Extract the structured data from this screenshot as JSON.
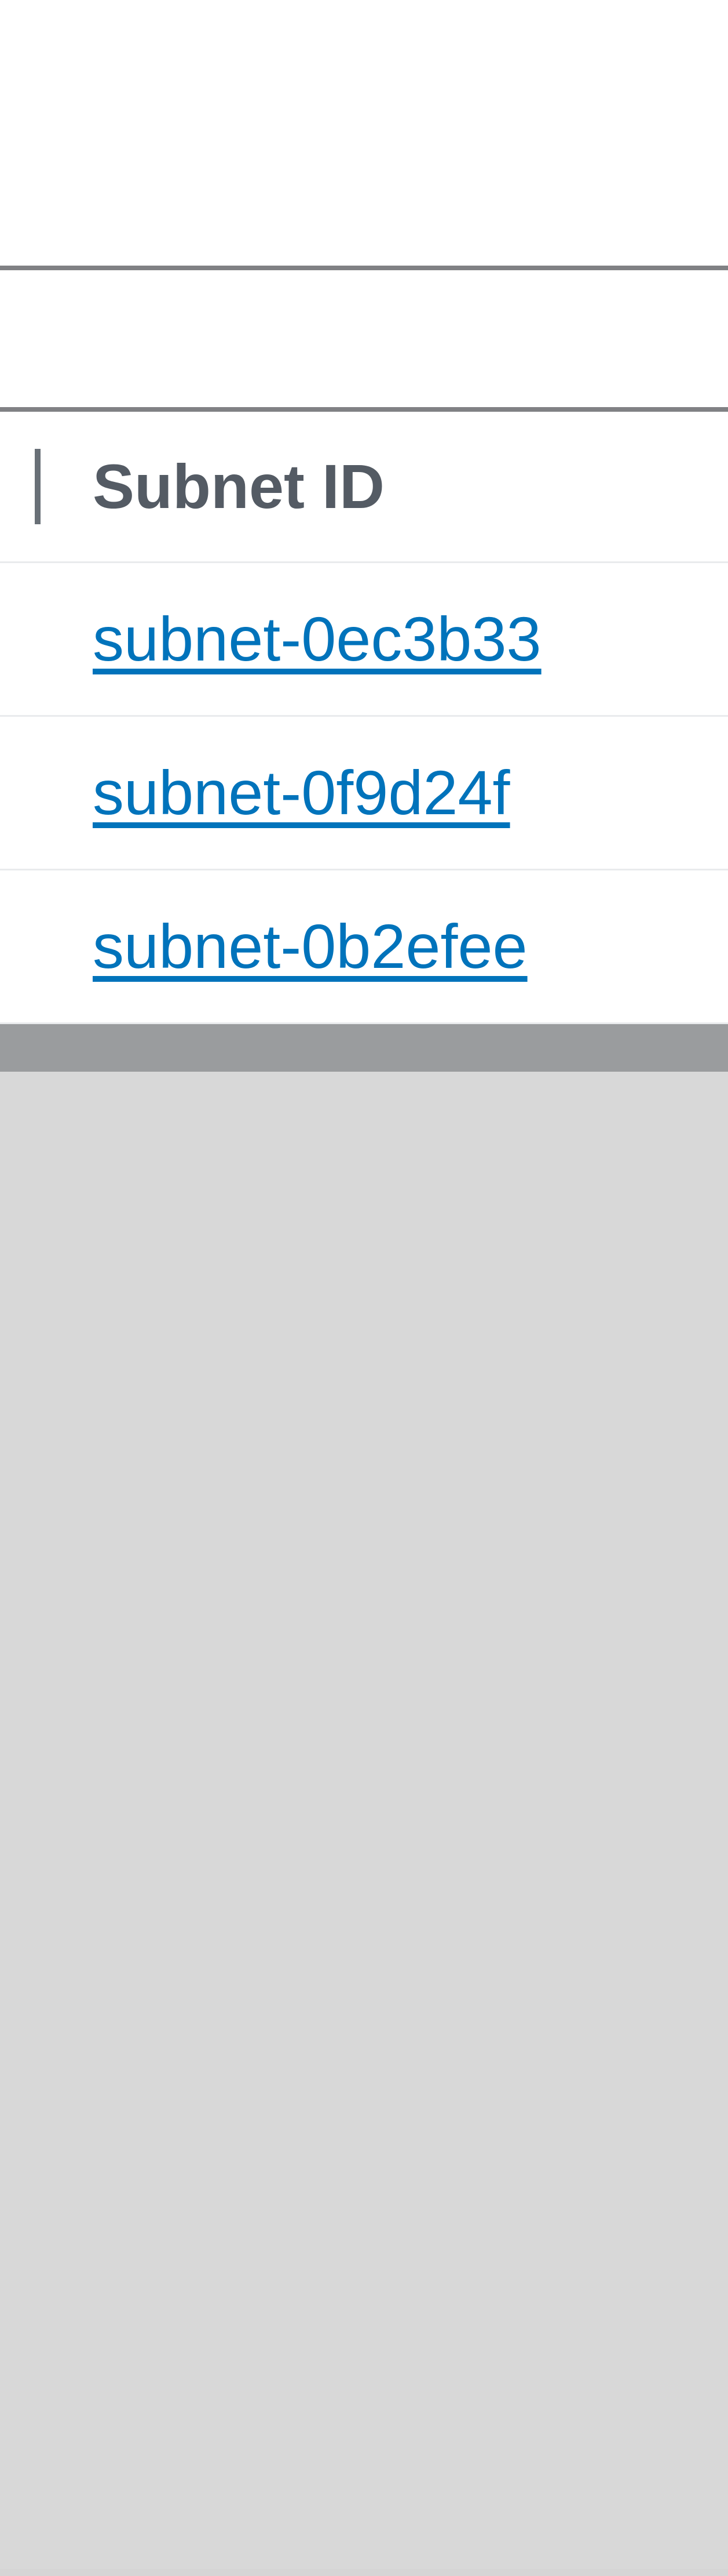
{
  "table": {
    "column_header": "Subnet ID",
    "rows": [
      {
        "subnet_id": "subnet-0ec3b33"
      },
      {
        "subnet_id": "subnet-0f9d24f"
      },
      {
        "subnet_id": "subnet-0b2efee"
      }
    ]
  }
}
